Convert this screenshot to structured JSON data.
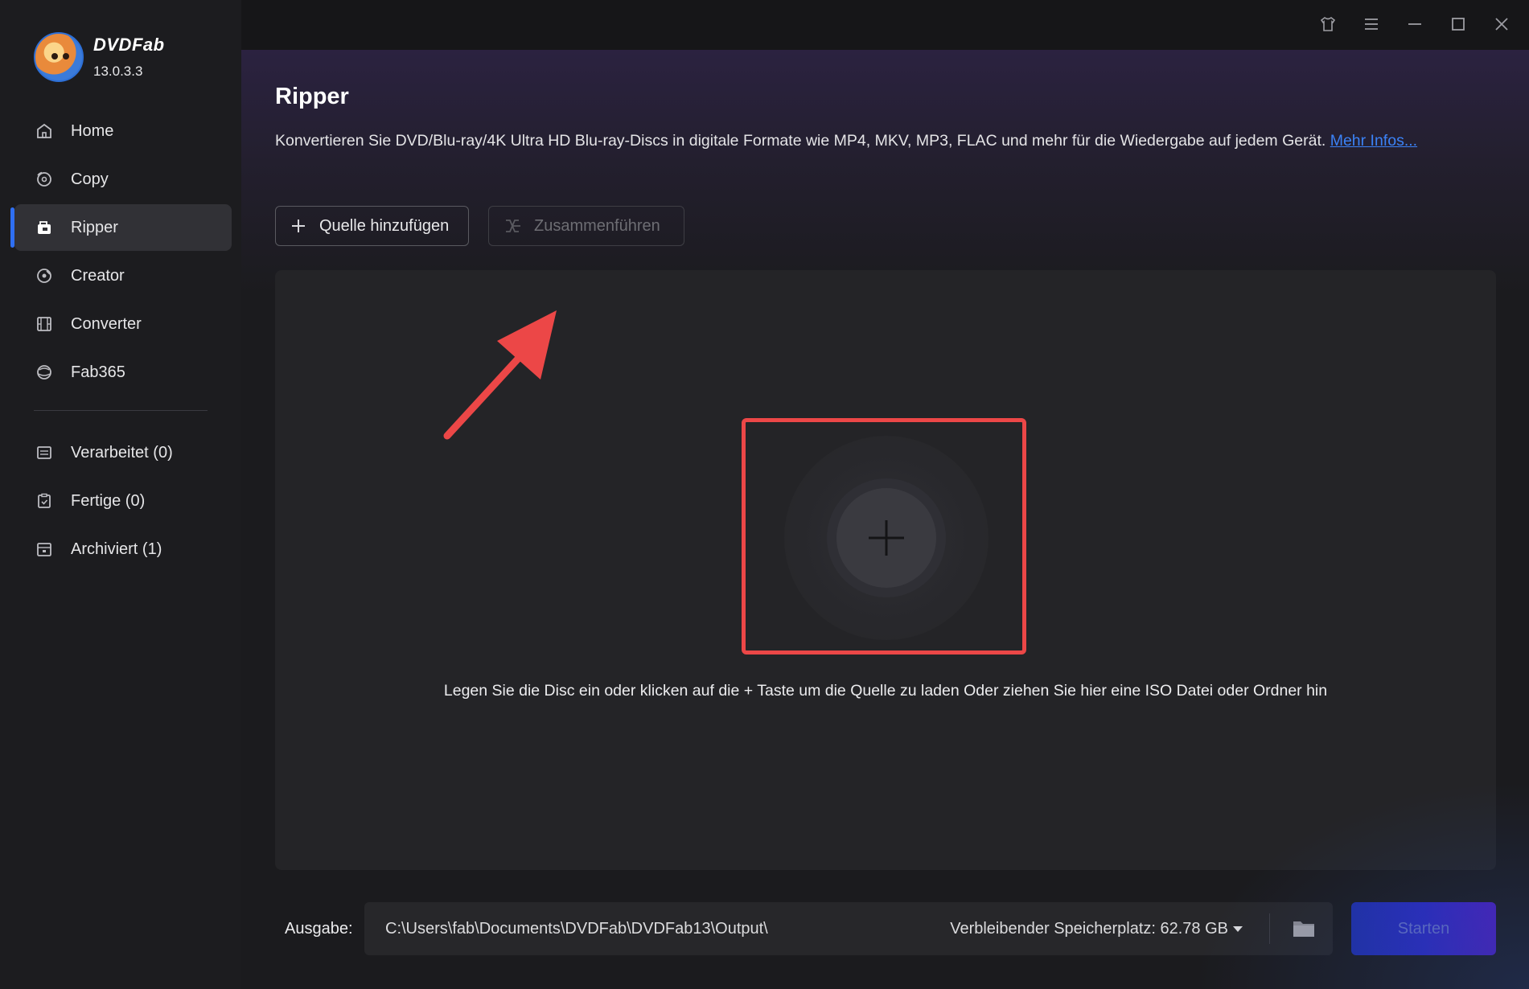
{
  "brand": {
    "name": "DVDFab",
    "version": "13.0.3.3"
  },
  "sidebar": {
    "items": [
      {
        "label": "Home",
        "icon": "home-icon"
      },
      {
        "label": "Copy",
        "icon": "copy-disc-icon"
      },
      {
        "label": "Ripper",
        "icon": "ripper-icon",
        "active": true
      },
      {
        "label": "Creator",
        "icon": "creator-disc-icon"
      },
      {
        "label": "Converter",
        "icon": "film-icon"
      },
      {
        "label": "Fab365",
        "icon": "fab365-icon"
      }
    ],
    "queue": [
      {
        "label": "Verarbeitet (0)",
        "icon": "list-icon"
      },
      {
        "label": "Fertige (0)",
        "icon": "clipboard-check-icon"
      },
      {
        "label": "Archiviert (1)",
        "icon": "archive-icon"
      }
    ]
  },
  "titlebar": {
    "icons": [
      "shirt-icon",
      "menu-icon",
      "minimize-icon",
      "maximize-icon",
      "close-icon"
    ]
  },
  "main": {
    "title": "Ripper",
    "description": "Konvertieren Sie DVD/Blu-ray/4K Ultra HD Blu-ray-Discs in digitale Formate wie MP4, MKV, MP3, FLAC und mehr für die Wiedergabe auf jedem Gerät.",
    "more_link": "Mehr Infos...",
    "add_source_label": "Quelle hinzufügen",
    "merge_label": "Zusammenführen",
    "drop_hint": "Legen Sie die Disc ein oder klicken auf die + Taste um die Quelle zu laden Oder ziehen Sie hier eine ISO Datei oder Ordner hin"
  },
  "footer": {
    "output_label": "Ausgabe:",
    "output_path": "C:\\Users\\fab\\Documents\\DVDFab\\DVDFab13\\Output\\",
    "free_space": "Verbleibender Speicherplatz: 62.78 GB",
    "start_label": "Starten"
  },
  "colors": {
    "accent": "#2f6ff2",
    "highlight": "#ec4747",
    "link": "#3b82f6"
  }
}
